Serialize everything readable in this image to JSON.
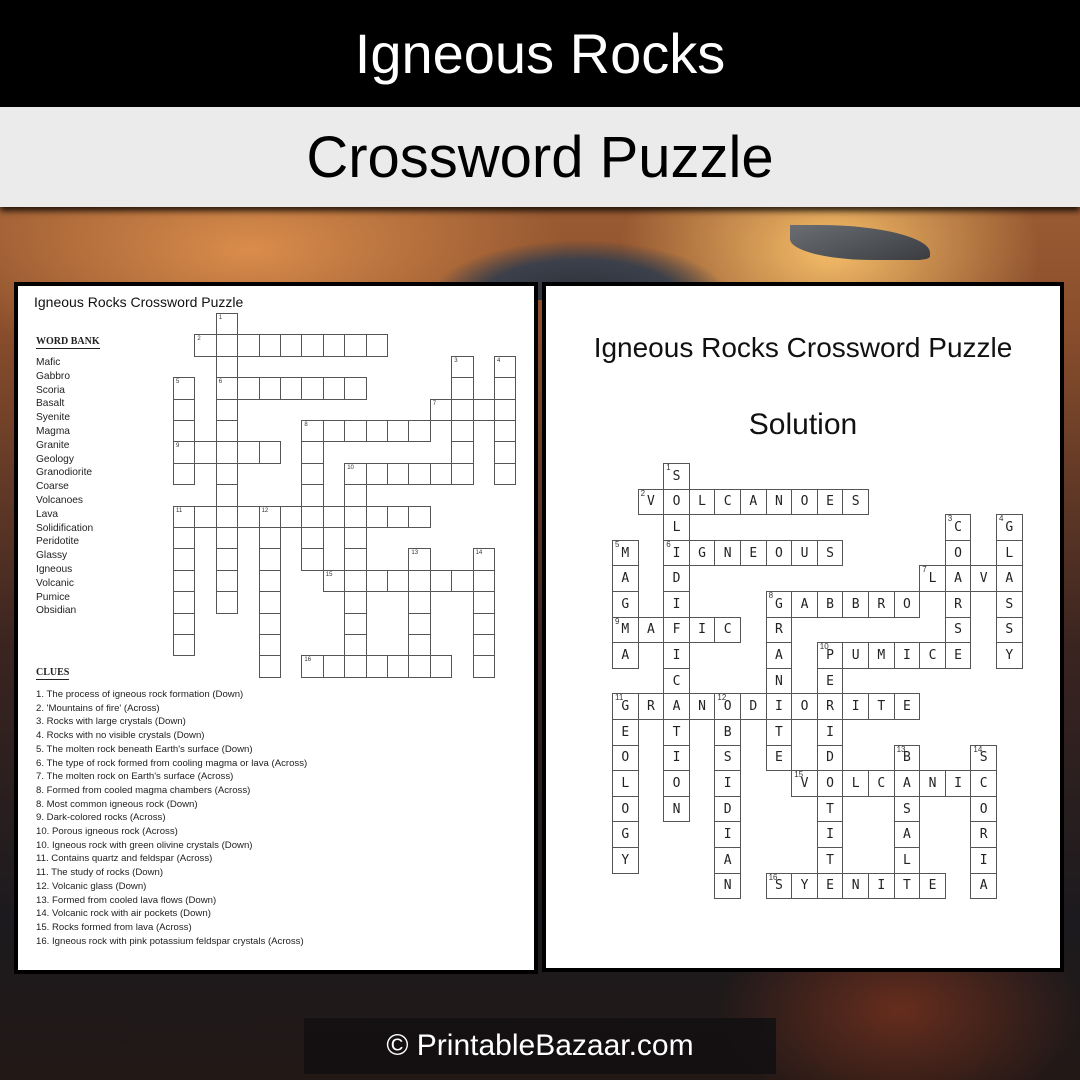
{
  "header": {
    "title": "Igneous Rocks",
    "subtitle": "Crossword Puzzle"
  },
  "puzzle_sheet": {
    "title": "Igneous Rocks Crossword Puzzle",
    "word_bank_heading": "WORD BANK",
    "word_bank": [
      "Mafic",
      "Gabbro",
      "Scoria",
      "Basalt",
      "Syenite",
      "Magma",
      "Granite",
      "Geology",
      "Granodiorite",
      "Coarse",
      "Volcanoes",
      "Lava",
      "Solidification",
      "Peridotite",
      "Glassy",
      "Igneous",
      "Volcanic",
      "Pumice",
      "Obsidian"
    ],
    "clues_heading": "CLUES",
    "clues": [
      "1. The process of igneous rock formation (Down)",
      "2. 'Mountains of fire' (Across)",
      "3. Rocks with large crystals (Down)",
      "4. Rocks with no visible crystals (Down)",
      "5. The molten rock beneath Earth's surface (Down)",
      "6. The type of rock formed from cooling magma or lava (Across)",
      "7. The molten rock on Earth's surface (Across)",
      "8. Formed from cooled magma chambers (Across)",
      "8. Most common  igneous rock (Down)",
      "9. Dark-colored rocks (Across)",
      "10. Porous igneous rock (Across)",
      "10. Igneous rock with green olivine crystals (Down)",
      "11. Contains quartz and feldspar (Across)",
      "11. The study of rocks (Down)",
      "12. Volcanic glass (Down)",
      "13. Formed from cooled lava flows (Down)",
      "14. Volcanic rock with air pockets (Down)",
      "15. Rocks formed from lava (Across)",
      "16. Igneous rock with pink potassium feldspar crystals (Across)"
    ]
  },
  "solution_sheet": {
    "title": "Igneous Rocks Crossword Puzzle",
    "subtitle": "Solution"
  },
  "crossword": {
    "entries": [
      {
        "num": 1,
        "dir": "down",
        "row": 0,
        "col": 2,
        "answer": "SOLIDIFICATION"
      },
      {
        "num": 2,
        "dir": "across",
        "row": 1,
        "col": 1,
        "answer": "VOLCANOES"
      },
      {
        "num": 3,
        "dir": "down",
        "row": 2,
        "col": 13,
        "answer": "COARSE"
      },
      {
        "num": 4,
        "dir": "down",
        "row": 2,
        "col": 15,
        "answer": "GLASSY"
      },
      {
        "num": 5,
        "dir": "down",
        "row": 3,
        "col": 0,
        "answer": "MAGMA"
      },
      {
        "num": 6,
        "dir": "across",
        "row": 3,
        "col": 2,
        "answer": "IGNEOUS"
      },
      {
        "num": 7,
        "dir": "across",
        "row": 4,
        "col": 12,
        "answer": "LAVA"
      },
      {
        "num": 8,
        "dir": "across",
        "row": 5,
        "col": 6,
        "answer": "GABBRO"
      },
      {
        "num": 8,
        "dir": "down",
        "row": 5,
        "col": 6,
        "answer": "GRANITE"
      },
      {
        "num": 9,
        "dir": "across",
        "row": 6,
        "col": 0,
        "answer": "MAFIC"
      },
      {
        "num": 10,
        "dir": "across",
        "row": 7,
        "col": 8,
        "answer": "PUMICE"
      },
      {
        "num": 10,
        "dir": "down",
        "row": 7,
        "col": 8,
        "answer": "PERIDOTITE"
      },
      {
        "num": 11,
        "dir": "across",
        "row": 9,
        "col": 0,
        "answer": "GRANODIORITE"
      },
      {
        "num": 11,
        "dir": "down",
        "row": 9,
        "col": 0,
        "answer": "GEOLOGY"
      },
      {
        "num": 12,
        "dir": "down",
        "row": 9,
        "col": 4,
        "answer": "OBSIDIAN"
      },
      {
        "num": 13,
        "dir": "down",
        "row": 11,
        "col": 11,
        "answer": "BASALT"
      },
      {
        "num": 14,
        "dir": "down",
        "row": 11,
        "col": 14,
        "answer": "SCORIA"
      },
      {
        "num": 15,
        "dir": "across",
        "row": 12,
        "col": 7,
        "answer": "VOLCANIC"
      },
      {
        "num": 16,
        "dir": "across",
        "row": 16,
        "col": 6,
        "answer": "SYENITE"
      }
    ]
  },
  "footer": {
    "copyright": "© PrintableBazaar.com"
  }
}
